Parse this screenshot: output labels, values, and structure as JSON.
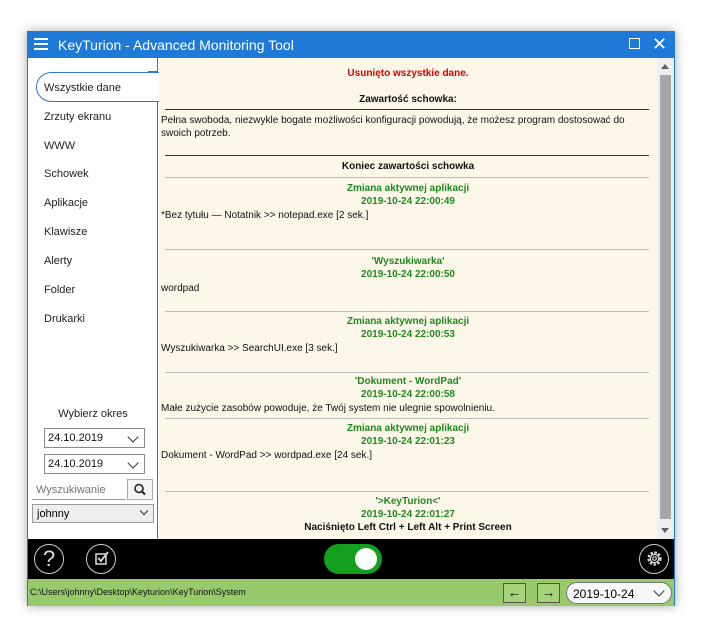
{
  "window": {
    "title": "KeyTurion - Advanced Monitoring Tool"
  },
  "sidebar": {
    "items": [
      {
        "label": "Wszystkie dane",
        "active": true
      },
      {
        "label": "Zrzuty ekranu"
      },
      {
        "label": "WWW"
      },
      {
        "label": "Schowek"
      },
      {
        "label": "Aplikacje"
      },
      {
        "label": "Klawisze"
      },
      {
        "label": "Alerty"
      },
      {
        "label": "Folder"
      },
      {
        "label": "Drukarki"
      }
    ],
    "period_label": "Wybierz okres",
    "date_from": "24.10.2019",
    "date_to": "24.10.2019",
    "search_placeholder": "Wyszukiwanie",
    "user": "johnny"
  },
  "content": {
    "deleted_notice": "Usunięto wszystkie dane.",
    "clipboard_header": "Zawartość schowka:",
    "clipboard_text": "Pełna swoboda, niezwykle bogate możliwości konfiguracji powodują, że możesz program dostosować do swoich potrzeb.",
    "clipboard_end": "Koniec zawartości schowka",
    "entries": [
      {
        "title": "Zmiana aktywnej aplikacji",
        "time": "2019-10-24 22:00:49",
        "detail": "*Bez tytułu — Notatnik >> notepad.exe [2 sek.]"
      },
      {
        "title": "'Wyszukiwarka'",
        "time": "2019-10-24 22:00:50",
        "detail": "wordpad"
      },
      {
        "title": "Zmiana aktywnej aplikacji",
        "time": "2019-10-24 22:00:53",
        "detail": "Wyszukiwarka >> SearchUI.exe [3 sek.]"
      },
      {
        "title": "'Dokument - WordPad'",
        "time": "2019-10-24 22:00:58",
        "detail": "Małe zużycie zasobów powoduje, że Twój system nie ulegnie spowolnieniu."
      },
      {
        "title": "Zmiana aktywnej aplikacji",
        "time": "2019-10-24 22:01:23",
        "detail": "Dokument - WordPad >> wordpad.exe [24 sek.]"
      },
      {
        "title": "'>KeyTurion<'",
        "time": "2019-10-24 22:01:27",
        "detail": "Naciśnięto Left Ctrl + Left Alt + Print Screen"
      }
    ]
  },
  "bottombar": {
    "help_icon": "question-icon",
    "tasks_icon": "checkbox-icon",
    "toggle_on": true,
    "settings_icon": "gear-icon"
  },
  "statusbar": {
    "path": "C:\\Users\\johnny\\Desktop\\Keyturion\\KeyTurion\\System",
    "date": "2019-10-24"
  },
  "colors": {
    "titlebar": "#1e7ad6",
    "content_bg": "#fdf7ea",
    "notice_red": "#d40000",
    "entry_green": "#1f8a1f",
    "toggle_green": "#14a01e",
    "statusbar_green": "#98c96a"
  }
}
